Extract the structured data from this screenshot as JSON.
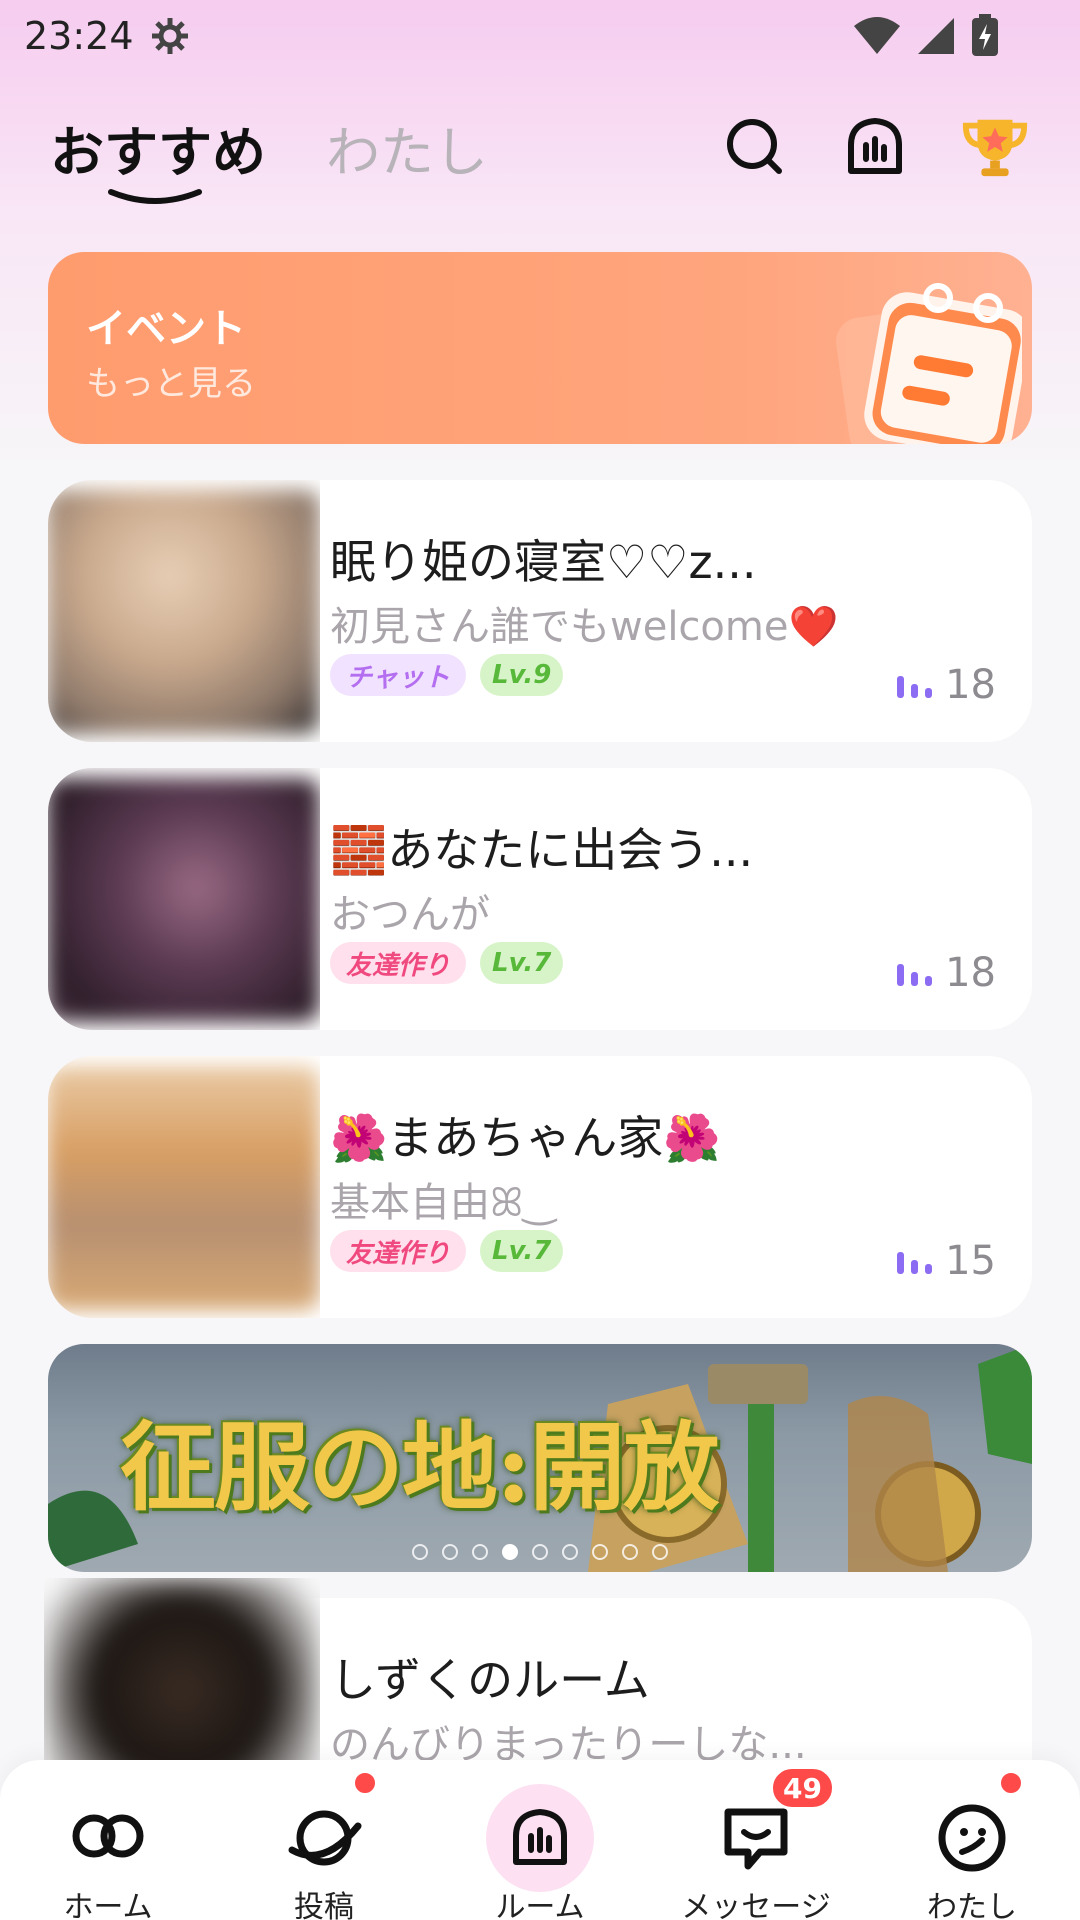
{
  "status": {
    "time": "23:24"
  },
  "header": {
    "tab_active": "おすすめ",
    "tab_inactive": "わたし",
    "icons": [
      "search-icon",
      "live-room-icon",
      "trophy-icon"
    ]
  },
  "event": {
    "title": "イベント",
    "subtitle": "もっと見る"
  },
  "rooms": [
    {
      "title": "眠り姫の寝室♡♡z...",
      "desc": "初見さん誰でもwelcome❤️",
      "category": "チャット",
      "level": "Lv.9",
      "count": "18"
    },
    {
      "title": "🧱あなたに出会う...",
      "desc": "おつんが",
      "category": "友達作り",
      "level": "Lv.7",
      "count": "18"
    },
    {
      "title": "🌺まあちゃん家🌺",
      "desc": "基本自由ꕤ‿",
      "category": "友達作り",
      "level": "Lv.7",
      "count": "15"
    },
    {
      "title": "しずくのルーム",
      "desc": "のんびりまったりーしな..."
    }
  ],
  "ad": {
    "title": "征服の地:開放",
    "dots": 9,
    "active_dot": 3
  },
  "nav": {
    "items": [
      {
        "label": "ホーム",
        "icon": "home-icon"
      },
      {
        "label": "投稿",
        "icon": "planet-icon"
      },
      {
        "label": "ルーム",
        "icon": "room-icon"
      },
      {
        "label": "メッセージ",
        "icon": "message-icon"
      },
      {
        "label": "わたし",
        "icon": "profile-icon"
      }
    ],
    "message_badge": "49"
  },
  "colors": {
    "accent_purple": "#8b6cf2",
    "event_orange": "#ffa57d",
    "badge_red": "#ff4a4a"
  }
}
